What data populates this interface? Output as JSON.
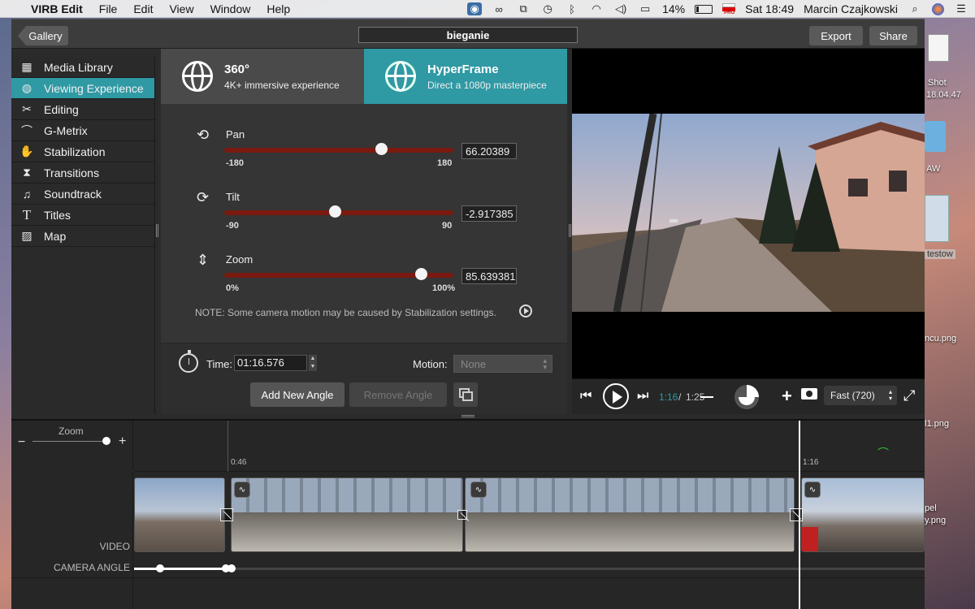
{
  "menubar": {
    "app_name": "VIRB Edit",
    "menus": [
      "File",
      "Edit",
      "View",
      "Window",
      "Help"
    ],
    "battery": "14%",
    "clock": "Sat 18:49",
    "user": "Marcin Czajkowski",
    "flag_badge": "PRO"
  },
  "desktop": {
    "labels": [
      "Shot",
      "18.04.47",
      "AW",
      "testow",
      "ncu.png",
      "l1.png",
      "pel",
      "y.png"
    ]
  },
  "window": {
    "gallery_label": "Gallery",
    "project_title": "bieganie",
    "export_label": "Export",
    "share_label": "Share"
  },
  "sidebar": {
    "items": [
      {
        "label": "Media Library",
        "icon": "film-icon"
      },
      {
        "label": "Viewing Experience",
        "icon": "globe-icon",
        "active": true
      },
      {
        "label": "Editing",
        "icon": "scissors-icon"
      },
      {
        "label": "G-Metrix",
        "icon": "gauge-icon"
      },
      {
        "label": "Stabilization",
        "icon": "hand-icon"
      },
      {
        "label": "Transitions",
        "icon": "transition-icon"
      },
      {
        "label": "Soundtrack",
        "icon": "music-note-icon"
      },
      {
        "label": "Titles",
        "icon": "text-t-icon"
      },
      {
        "label": "Map",
        "icon": "map-icon"
      }
    ]
  },
  "modes": {
    "m360": {
      "title": "360°",
      "subtitle": "4K+ immersive experience"
    },
    "hyperframe": {
      "title": "HyperFrame",
      "subtitle": "Direct a 1080p masterpiece",
      "active": true
    },
    "active_color": "#2f99a4"
  },
  "params": {
    "pan": {
      "label": "Pan",
      "min_label": "-180",
      "max_label": "180",
      "value": "66.20389",
      "min": -180,
      "max": 180,
      "num": 66.20389
    },
    "tilt": {
      "label": "Tilt",
      "min_label": "-90",
      "max_label": "90",
      "value": "-2.917385",
      "min": -90,
      "max": 90,
      "num": -2.917385
    },
    "zoom": {
      "label": "Zoom",
      "min_label": "0%",
      "max_label": "100%",
      "value": "85.639381",
      "min": 0,
      "max": 100,
      "num": 85.639381
    },
    "track_color": "#7a1a10"
  },
  "note": "NOTE: Some camera motion may be caused by Stabilization settings.",
  "controls": {
    "time_label": "Time:",
    "time_value": "01:16.576",
    "motion_label": "Motion:",
    "motion_value": "None",
    "add_angle": "Add New Angle",
    "remove_angle": "Remove Angle"
  },
  "transport": {
    "current_time": "1:16",
    "separator": "/",
    "total_time": "1:25",
    "quality": "Fast (720)"
  },
  "timeline": {
    "zoom_label": "Zoom",
    "zoom_minus": "−",
    "zoom_plus": "+",
    "zoom_level": 0.82,
    "time_marker_1": "0:46",
    "time_marker_2": "1:16",
    "video_track_label": "VIDEO",
    "camera_angle_label": "CAMERA ANGLE"
  }
}
